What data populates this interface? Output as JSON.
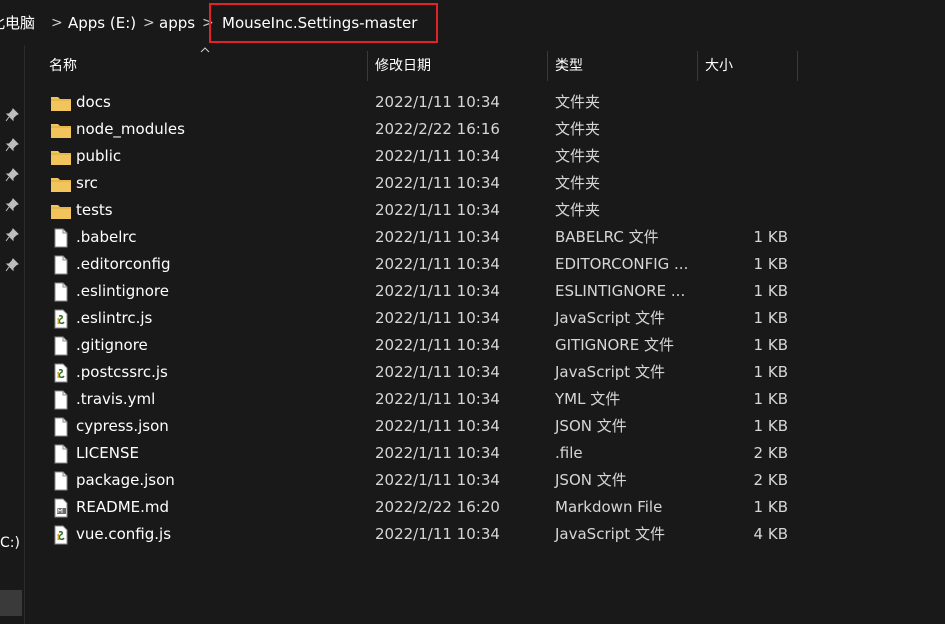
{
  "breadcrumb": {
    "items": [
      "此电脑",
      "Apps (E:)",
      "apps",
      "MouseInc.Settings-master"
    ],
    "separator": ">"
  },
  "nav_pane": {
    "drive_label": "C:)"
  },
  "columns": [
    "名称",
    "修改日期",
    "类型",
    "大小"
  ],
  "files": [
    {
      "name": "docs",
      "date": "2022/1/11 10:34",
      "type": "文件夹",
      "size": "",
      "icon": "folder-icon"
    },
    {
      "name": "node_modules",
      "date": "2022/2/22 16:16",
      "type": "文件夹",
      "size": "",
      "icon": "folder-icon"
    },
    {
      "name": "public",
      "date": "2022/1/11 10:34",
      "type": "文件夹",
      "size": "",
      "icon": "folder-icon"
    },
    {
      "name": "src",
      "date": "2022/1/11 10:34",
      "type": "文件夹",
      "size": "",
      "icon": "folder-icon"
    },
    {
      "name": "tests",
      "date": "2022/1/11 10:34",
      "type": "文件夹",
      "size": "",
      "icon": "folder-icon"
    },
    {
      "name": ".babelrc",
      "date": "2022/1/11 10:34",
      "type": "BABELRC 文件",
      "size": "1 KB",
      "icon": "file-icon"
    },
    {
      "name": ".editorconfig",
      "date": "2022/1/11 10:34",
      "type": "EDITORCONFIG ...",
      "size": "1 KB",
      "icon": "file-icon"
    },
    {
      "name": ".eslintignore",
      "date": "2022/1/11 10:34",
      "type": "ESLINTIGNORE ...",
      "size": "1 KB",
      "icon": "file-icon"
    },
    {
      "name": ".eslintrc.js",
      "date": "2022/1/11 10:34",
      "type": "JavaScript 文件",
      "size": "1 KB",
      "icon": "js-file-icon"
    },
    {
      "name": ".gitignore",
      "date": "2022/1/11 10:34",
      "type": "GITIGNORE 文件",
      "size": "1 KB",
      "icon": "file-icon"
    },
    {
      "name": ".postcssrc.js",
      "date": "2022/1/11 10:34",
      "type": "JavaScript 文件",
      "size": "1 KB",
      "icon": "js-file-icon"
    },
    {
      "name": ".travis.yml",
      "date": "2022/1/11 10:34",
      "type": "YML 文件",
      "size": "1 KB",
      "icon": "file-icon"
    },
    {
      "name": "cypress.json",
      "date": "2022/1/11 10:34",
      "type": "JSON 文件",
      "size": "1 KB",
      "icon": "file-icon"
    },
    {
      "name": "LICENSE",
      "date": "2022/1/11 10:34",
      "type": ".file",
      "size": "2 KB",
      "icon": "file-icon"
    },
    {
      "name": "package.json",
      "date": "2022/1/11 10:34",
      "type": "JSON 文件",
      "size": "2 KB",
      "icon": "file-icon"
    },
    {
      "name": "README.md",
      "date": "2022/2/22 16:20",
      "type": "Markdown File",
      "size": "1 KB",
      "icon": "markdown-file-icon"
    },
    {
      "name": "vue.config.js",
      "date": "2022/1/11 10:34",
      "type": "JavaScript 文件",
      "size": "4 KB",
      "icon": "js-file-icon"
    }
  ],
  "colors": {
    "background": "#191919",
    "folder": "#f2c55c",
    "highlight_box": "#e0222d",
    "text": "#ffffff"
  }
}
